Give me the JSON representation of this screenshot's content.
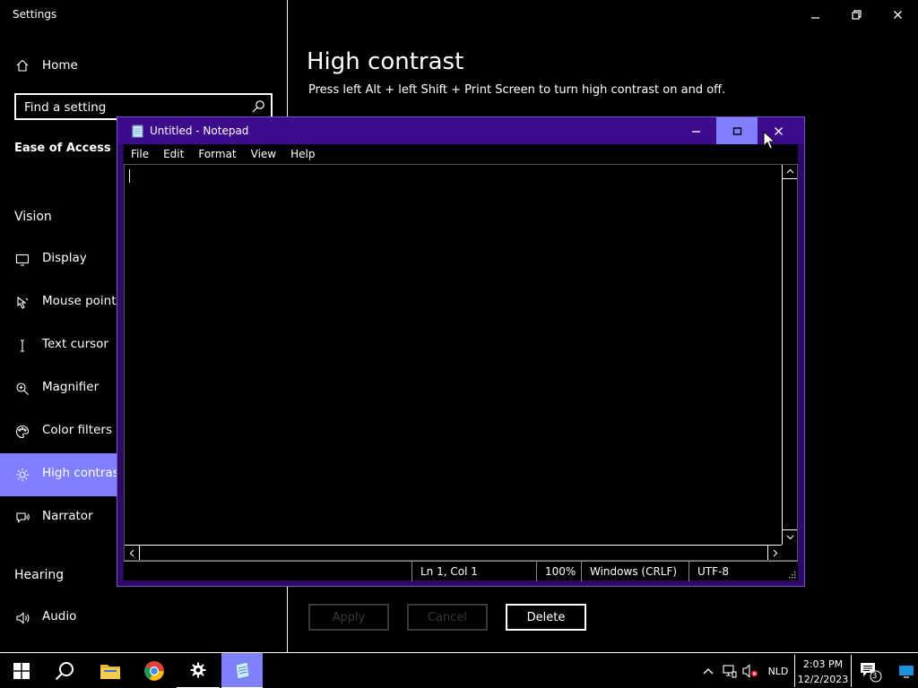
{
  "settings": {
    "app_title": "Settings",
    "nav_home": "Home",
    "search_placeholder": "Find a setting",
    "section_label": "Ease of Access",
    "groups": {
      "vision": "Vision",
      "hearing": "Hearing"
    },
    "nav_items": [
      {
        "label": "Display",
        "icon": "monitor-icon"
      },
      {
        "label": "Mouse pointer",
        "icon": "mouse-pointer-icon"
      },
      {
        "label": "Text cursor",
        "icon": "text-cursor-icon"
      },
      {
        "label": "Magnifier",
        "icon": "magnifier-icon"
      },
      {
        "label": "Color filters",
        "icon": "color-filters-icon"
      },
      {
        "label": "High contrast",
        "icon": "high-contrast-icon",
        "active": true
      },
      {
        "label": "Narrator",
        "icon": "narrator-icon"
      },
      {
        "label": "Audio",
        "icon": "audio-icon"
      }
    ],
    "page_title": "High contrast",
    "page_description": "Press left Alt + left Shift + Print Screen to turn high contrast on and off.",
    "buttons": {
      "apply": "Apply",
      "cancel": "Cancel",
      "delete": "Delete"
    }
  },
  "notepad": {
    "title": "Untitled - Notepad",
    "menu": [
      "File",
      "Edit",
      "Format",
      "View",
      "Help"
    ],
    "content": "",
    "status": {
      "position": "Ln 1, Col 1",
      "zoom": "100%",
      "line_ending": "Windows (CRLF)",
      "encoding": "UTF-8"
    }
  },
  "taskbar": {
    "language": "NLD",
    "time": "2:03 PM",
    "date": "12/2/2023",
    "notification_count": "3"
  },
  "colors": {
    "accent": "#8080ff",
    "notepad_frame": "#2d0a66",
    "notepad_titlebar": "#3c0c8c",
    "disabled_text": "#3a3a3a"
  }
}
